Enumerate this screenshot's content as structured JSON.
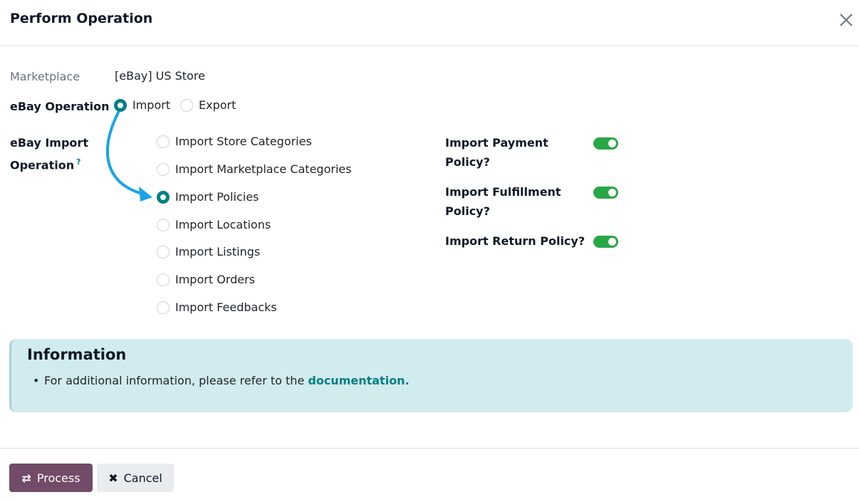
{
  "dialog": {
    "title": "Perform Operation"
  },
  "form": {
    "marketplace_label": "Marketplace",
    "marketplace_value": "[eBay] US Store",
    "operation_label": "eBay Operation",
    "operation_options": [
      "Import",
      "Export"
    ],
    "operation_selected": "Import",
    "import_op_label_line1": "eBay Import",
    "import_op_label_line2": "Operation",
    "import_op_help": "?",
    "import_options": [
      "Import Store Categories",
      "Import Marketplace Categories",
      "Import Policies",
      "Import Locations",
      "Import Listings",
      "Import Orders",
      "Import Feedbacks"
    ],
    "import_selected": "Import Policies",
    "policies": [
      {
        "line1": "Import Payment",
        "line2": "Policy?",
        "enabled": true
      },
      {
        "line1": "Import Fulfillment",
        "line2": "Policy?",
        "enabled": true
      },
      {
        "line1": "Import Return Policy?",
        "line2": "",
        "enabled": true
      }
    ]
  },
  "info": {
    "title": "Information",
    "text": "For additional information, please refer to the ",
    "link": "documentation."
  },
  "footer": {
    "process_label": "Process",
    "cancel_label": "Cancel"
  },
  "colors": {
    "primary": "#714b67",
    "accent": "#017e84",
    "toggle_on": "#28a745",
    "annotation_arrow": "#1aa3e8"
  }
}
